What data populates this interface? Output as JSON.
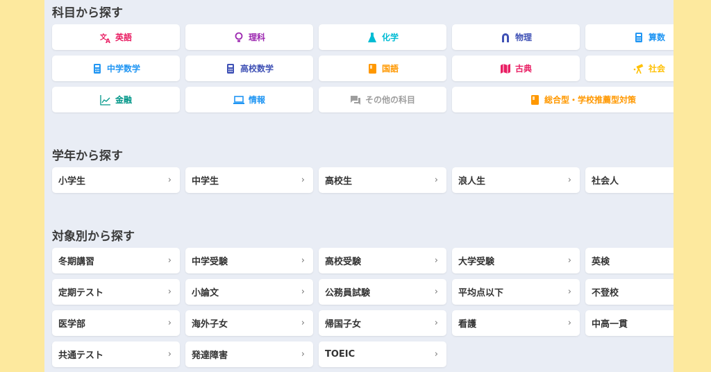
{
  "subjects": {
    "title": "科目から探す",
    "items": [
      {
        "label": "英語",
        "icon": "translate-icon",
        "color": "#e91e63"
      },
      {
        "label": "理科",
        "icon": "lightbulb-icon",
        "color": "#9c27b0"
      },
      {
        "label": "化学",
        "icon": "flask-icon",
        "color": "#00bcd4"
      },
      {
        "label": "物理",
        "icon": "magnet-icon",
        "color": "#3f51b5"
      },
      {
        "label": "算数",
        "icon": "calculator-icon",
        "color": "#2196f3"
      },
      {
        "label": "中学数学",
        "icon": "calculator-icon",
        "color": "#2196f3"
      },
      {
        "label": "高校数学",
        "icon": "calculator-icon",
        "color": "#3f51b5"
      },
      {
        "label": "国語",
        "icon": "book-icon",
        "color": "#ff9800"
      },
      {
        "label": "古典",
        "icon": "map-icon",
        "color": "#e91e63"
      },
      {
        "label": "社会",
        "icon": "telescope-icon",
        "color": "#ffc107"
      },
      {
        "label": "金融",
        "icon": "chart-line-icon",
        "color": "#009688"
      },
      {
        "label": "情報",
        "icon": "laptop-icon",
        "color": "#2196f3"
      },
      {
        "label": "その他の科目",
        "icon": "chat-icon",
        "color": "#9e9e9e"
      },
      {
        "label": "総合型・学校推薦型対策",
        "icon": "book-icon",
        "color": "#ff9800",
        "wide": true
      }
    ]
  },
  "grades": {
    "title": "学年から探す",
    "items": [
      "小学生",
      "中学生",
      "高校生",
      "浪人生",
      "社会人"
    ]
  },
  "targets": {
    "title": "対象別から探す",
    "items": [
      "冬期講習",
      "中学受験",
      "高校受験",
      "大学受験",
      "英検",
      "定期テスト",
      "小論文",
      "公務員試験",
      "平均点以下",
      "不登校",
      "医学部",
      "海外子女",
      "帰国子女",
      "看護",
      "中高一貫",
      "共通テスト",
      "発達障害",
      "TOEIC"
    ]
  },
  "chevron": "›"
}
